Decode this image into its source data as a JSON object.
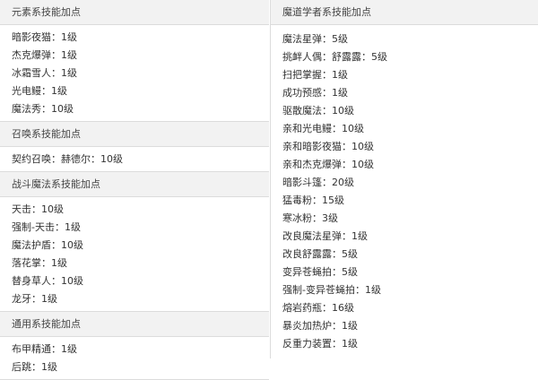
{
  "left_sections": [
    {
      "header": "元素系技能加点",
      "rows": [
        "暗影夜猫：1级",
        "杰克爆弹：1级",
        "冰霜雪人：1级",
        "光电鳗：1级",
        "魔法秀：10级"
      ]
    },
    {
      "header": "召唤系技能加点",
      "rows": [
        "契约召唤：赫德尔：10级"
      ]
    },
    {
      "header": "战斗魔法系技能加点",
      "rows": [
        "天击：10级",
        "强制-天击：1级",
        "魔法护盾：10级",
        "落花掌：1级",
        "替身草人：10级",
        "龙牙：1级"
      ]
    },
    {
      "header": "通用系技能加点",
      "rows": [
        "布甲精通：1级",
        "后跳：1级"
      ]
    }
  ],
  "right_section": {
    "header": "魔道学者系技能加点",
    "rows": [
      "魔法星弹：5级",
      "挑衅人偶：舒露露：5级",
      "扫把掌握：1级",
      "成功预感：1级",
      "驱散魔法：10级",
      "亲和光电鳗：10级",
      "亲和暗影夜猫：10级",
      "亲和杰克爆弹：10级",
      "暗影斗篷：20级",
      "猛毒粉：15级",
      "寒冰粉：3级",
      "改良魔法星弹：1级",
      "改良舒露露：5级",
      "变异苍蝇拍：5级",
      "强制-变异苍蝇拍：1级",
      "熔岩药瓶：16级",
      "暴炎加热炉：1级",
      "反重力装置：1级"
    ]
  }
}
